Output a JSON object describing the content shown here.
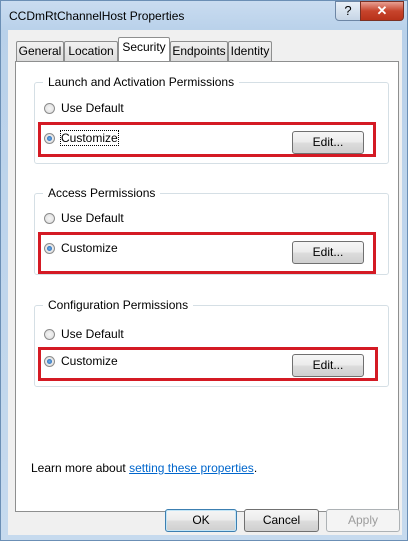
{
  "window": {
    "title": "CCDmRtChannelHost Properties",
    "help_label": "?",
    "close_label": "✕"
  },
  "tabs": [
    {
      "label": "General"
    },
    {
      "label": "Location"
    },
    {
      "label": "Security",
      "active": true
    },
    {
      "label": "Endpoints"
    },
    {
      "label": "Identity"
    }
  ],
  "groups": [
    {
      "title": "Launch and Activation Permissions",
      "use_default": "Use Default",
      "customize": "Customize",
      "edit": "Edit...",
      "selected": "customize"
    },
    {
      "title": "Access Permissions",
      "use_default": "Use Default",
      "customize": "Customize",
      "edit": "Edit...",
      "selected": "customize"
    },
    {
      "title": "Configuration Permissions",
      "use_default": "Use Default",
      "customize": "Customize",
      "edit": "Edit...",
      "selected": "customize"
    }
  ],
  "footer": {
    "text": "Learn more about ",
    "link": "setting these properties",
    "suffix": "."
  },
  "buttons": {
    "ok": "OK",
    "cancel": "Cancel",
    "apply": "Apply"
  },
  "colors": {
    "highlight_box": "#d41a24",
    "link": "#0066cc"
  }
}
